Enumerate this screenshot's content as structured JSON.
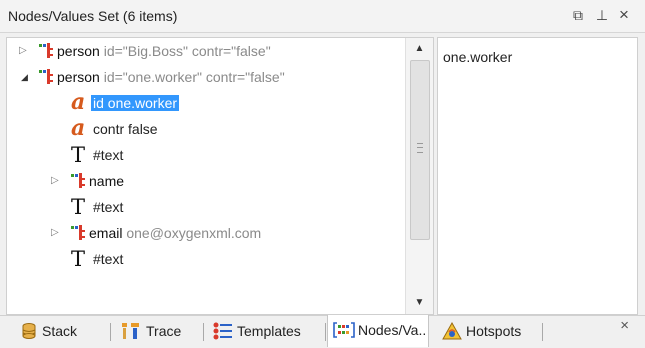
{
  "window": {
    "title": "Nodes/Values Set (6 items)",
    "restore_glyph": "⧉",
    "pin_glyph": "⊥",
    "close_glyph": "×"
  },
  "tree": {
    "rows": [
      {
        "kind": "element",
        "arrow": "▷",
        "name": "person",
        "attrs": "id=\"Big.Boss\" contr=\"false\""
      },
      {
        "kind": "element",
        "arrow": "◢",
        "name": "person",
        "attrs": "id=\"one.worker\" contr=\"false\""
      },
      {
        "kind": "attribute",
        "label": "id one.worker",
        "selected": true
      },
      {
        "kind": "attribute",
        "label": "contr false"
      },
      {
        "kind": "text",
        "label": "#text"
      },
      {
        "kind": "element",
        "arrow": "▷",
        "name": "name",
        "attrs": ""
      },
      {
        "kind": "text",
        "label": "#text"
      },
      {
        "kind": "element",
        "arrow": "▷",
        "name": "email",
        "attrs": "one@oxygenxml.com"
      },
      {
        "kind": "text",
        "label": "#text"
      }
    ],
    "attr_glyph": "a",
    "text_glyph": "T"
  },
  "value_pane": {
    "text": "one.worker"
  },
  "tabs": [
    {
      "id": "stack",
      "label": "Stack"
    },
    {
      "id": "trace",
      "label": "Trace"
    },
    {
      "id": "templates",
      "label": "Templates"
    },
    {
      "id": "nodes",
      "label": "Nodes/Va..",
      "active": true
    },
    {
      "id": "hotspots",
      "label": "Hotspots"
    }
  ],
  "colors": {
    "selection": "#3297fd",
    "attr_icon": "#d65a1d",
    "element_icon_green": "#3a9a2c",
    "element_icon_red": "#d93a2b",
    "element_icon_blue": "#2b62c8"
  }
}
